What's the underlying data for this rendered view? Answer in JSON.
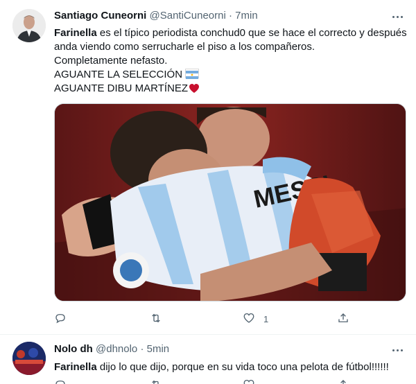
{
  "tweets": [
    {
      "display_name": "Santiago Cuneorni",
      "handle": "@SantiCuneorni",
      "separator": "·",
      "time": "7min",
      "text": {
        "mention": "Farinella",
        "line1_rest": " es el típico periodista conchud0 que se hace el correcto y después",
        "line2": "anda viendo como serrucharle el piso a los compañeros.",
        "line3": "Completamente nefasto.",
        "line4": "AGUANTE LA SELECCIÓN",
        "line5": "AGUANTE DIBU MARTÍNEZ"
      },
      "photo_text": "MESSI",
      "actions": {
        "reply": "",
        "retweet": "",
        "like": "1",
        "share": ""
      },
      "icons": [
        "argentina-flag-icon",
        "red-heart-icon",
        "reply-icon",
        "retweet-icon",
        "like-icon",
        "share-icon",
        "more-options-icon"
      ]
    },
    {
      "display_name": "Nolo dh",
      "handle": "@dhnolo",
      "separator": "·",
      "time": "5min",
      "text": {
        "mention": "Farinella",
        "rest": " dijo lo que dijo, porque en su vida toco una pelota de fútbol!!!!!!"
      }
    }
  ],
  "colors": {
    "text_primary": "#0f1419",
    "text_secondary": "#536471",
    "heart_red": "#c8102e",
    "flag_blue": "#74acdf"
  }
}
